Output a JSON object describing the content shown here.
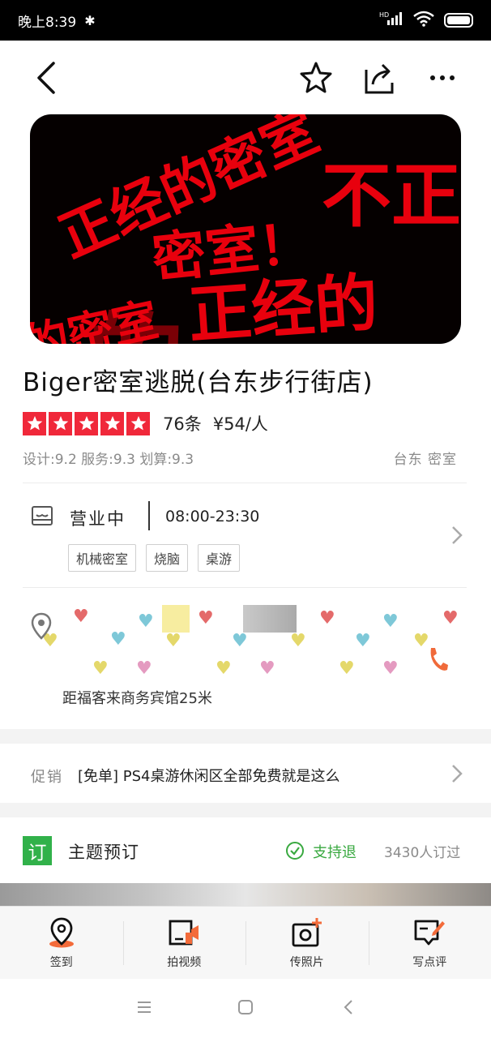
{
  "status_bar": {
    "time": "晚上8:39",
    "network": "HD"
  },
  "banner": {
    "texts": [
      "正经的密室",
      "不正",
      "密室！",
      "正经的",
      "的密室",
      "的"
    ]
  },
  "shop": {
    "title": "Biger密室逃脱(台东步行街店)",
    "rating_stars": 5,
    "review_count": "76条",
    "price": "¥54/人",
    "scores": "设计:9.2  服务:9.3  划算:9.3",
    "region": "台东  密室"
  },
  "hours": {
    "status": "营业中",
    "time": "08:00-23:30",
    "tags": [
      "机械密室",
      "烧脑",
      "桌游"
    ]
  },
  "location": {
    "distance": "距福客来商务宾馆25米"
  },
  "promo": {
    "label": "促销",
    "text": "[免单] PS4桌游休闲区全部免费就是这么"
  },
  "booking": {
    "badge": "订",
    "title": "主题预订",
    "refund": "支持退",
    "count": "3430人订过"
  },
  "toolbar": {
    "items": [
      {
        "label": "签到",
        "icon": "checkin-pin-icon"
      },
      {
        "label": "拍视频",
        "icon": "video-icon"
      },
      {
        "label": "传照片",
        "icon": "photo-upload-icon"
      },
      {
        "label": "写点评",
        "icon": "write-review-icon"
      }
    ]
  },
  "colors": {
    "accent_red": "#f0283a",
    "green": "#31b14a",
    "banner_red": "#e8000d"
  }
}
